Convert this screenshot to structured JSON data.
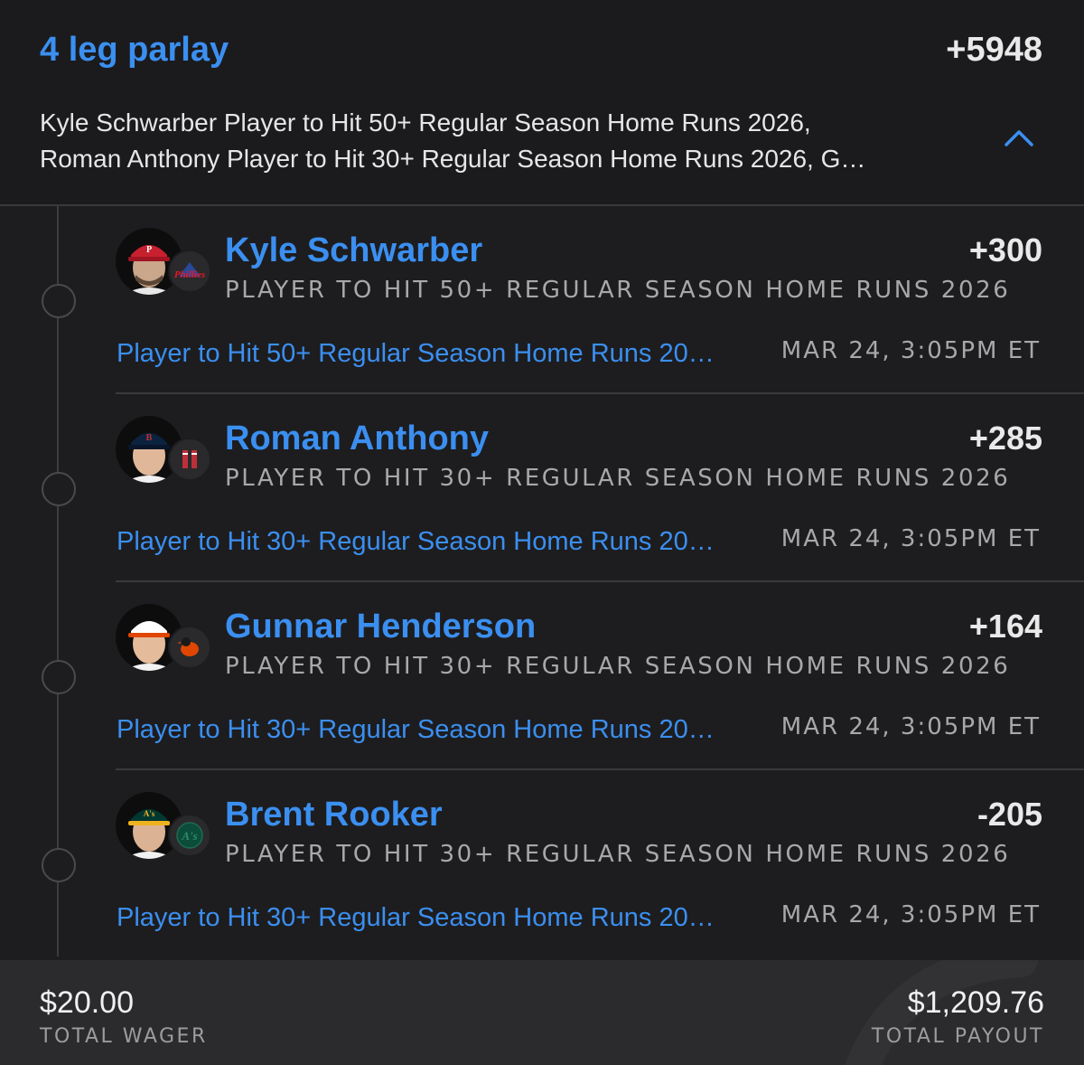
{
  "parlay": {
    "title": "4 leg parlay",
    "odds": "+5948",
    "description": "Kyle Schwarber Player to Hit 50+ Regular Season Home Runs 2026,\nRoman Anthony Player to Hit 30+ Regular Season Home Runs 2026, G…",
    "collapse_icon": "chevron-up-icon"
  },
  "legs": [
    {
      "player": "Kyle Schwarber",
      "odds": "+300",
      "market": "PLAYER TO HIT 50+ REGULAR SEASON HOME RUNS 2026",
      "selection": "Player to Hit 50+ Regular Season Home Runs 20…",
      "start_time": "MAR 24, 3:05PM ET",
      "team": "Phillies",
      "cap_color": "#c8202f",
      "logo_color": "#e81828"
    },
    {
      "player": "Roman Anthony",
      "odds": "+285",
      "market": "PLAYER TO HIT 30+ REGULAR SEASON HOME RUNS 2026",
      "selection": "Player to Hit 30+ Regular Season Home Runs 20…",
      "start_time": "MAR 24, 3:05PM ET",
      "team": "Red Sox",
      "cap_color": "#0c2340",
      "logo_color": "#bd3039"
    },
    {
      "player": "Gunnar Henderson",
      "odds": "+164",
      "market": "PLAYER TO HIT 30+ REGULAR SEASON HOME RUNS 2026",
      "selection": "Player to Hit 30+ Regular Season Home Runs 20…",
      "start_time": "MAR 24, 3:05PM ET",
      "team": "Orioles",
      "cap_color": "#1a1a1a",
      "logo_color": "#df4601"
    },
    {
      "player": "Brent Rooker",
      "odds": "-205",
      "market": "PLAYER TO HIT 30+ REGULAR SEASON HOME RUNS 2026",
      "selection": "Player to Hit 30+ Regular Season Home Runs 20…",
      "start_time": "MAR 24, 3:05PM ET",
      "team": "Athletics",
      "cap_color": "#003831",
      "logo_color": "#0b4d3a"
    }
  ],
  "footer": {
    "wager_amount": "$20.00",
    "wager_label": "TOTAL WAGER",
    "payout_amount": "$1,209.76",
    "payout_label": "TOTAL PAYOUT"
  },
  "colors": {
    "accent": "#3b8ff0",
    "background": "#1d1d1f",
    "footer_bg": "#2b2b2d",
    "muted_text": "#a8a8aa"
  }
}
